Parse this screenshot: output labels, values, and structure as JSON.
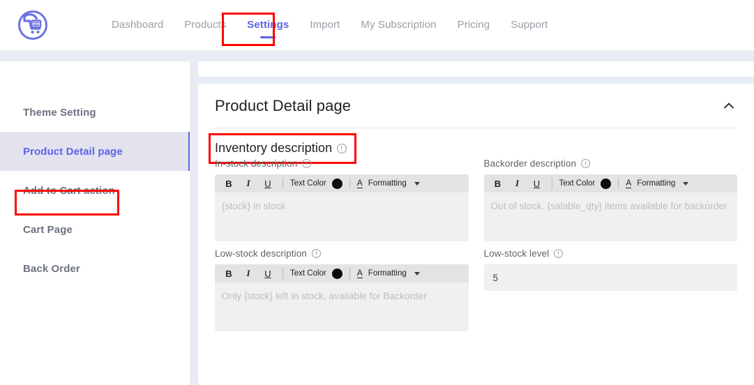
{
  "app": {
    "logo_icon": "cart-return-logo-icon",
    "accent_color": "#5c63e8",
    "highlight_color": "#fe0000"
  },
  "topnav": {
    "items": [
      {
        "label": "Dashboard",
        "active": false
      },
      {
        "label": "Products",
        "active": false
      },
      {
        "label": "Settings",
        "active": true
      },
      {
        "label": "Import",
        "active": false
      },
      {
        "label": "My Subscription",
        "active": false
      },
      {
        "label": "Pricing",
        "active": false
      },
      {
        "label": "Support",
        "active": false
      }
    ]
  },
  "sidebar": {
    "items": [
      {
        "label": "Theme Setting",
        "active": false
      },
      {
        "label": "Product Detail page",
        "active": true
      },
      {
        "label": "Add to Cart action",
        "active": false
      },
      {
        "label": "Cart Page",
        "active": false
      },
      {
        "label": "Back Order",
        "active": false
      }
    ]
  },
  "card": {
    "title": "Product Detail page",
    "collapse_icon": "chevron-up-icon"
  },
  "section": {
    "title": "Inventory description",
    "info_icon": "info-circle-icon"
  },
  "editor_toolbar": {
    "bold_label": "B",
    "italic_label": "I",
    "underline_label": "U",
    "text_color_label": "Text Color",
    "text_color_value": "#0d0d0d",
    "formatting_label": "Formatting",
    "formatting_glyph": "A",
    "caret_icon": "chevron-down-icon"
  },
  "fields": {
    "in_stock": {
      "label": "In-stock description",
      "placeholder": "{stock} in stock",
      "value": ""
    },
    "backorder": {
      "label": "Backorder description",
      "placeholder": "Out of stock. {salable_qty} items available for backorder",
      "value": ""
    },
    "low_stock_desc": {
      "label": "Low-stock description",
      "placeholder": "Only {stock} left in stock, available for Backorder",
      "value": ""
    },
    "low_stock_level": {
      "label": "Low-stock level",
      "value": "5",
      "placeholder": ""
    }
  }
}
